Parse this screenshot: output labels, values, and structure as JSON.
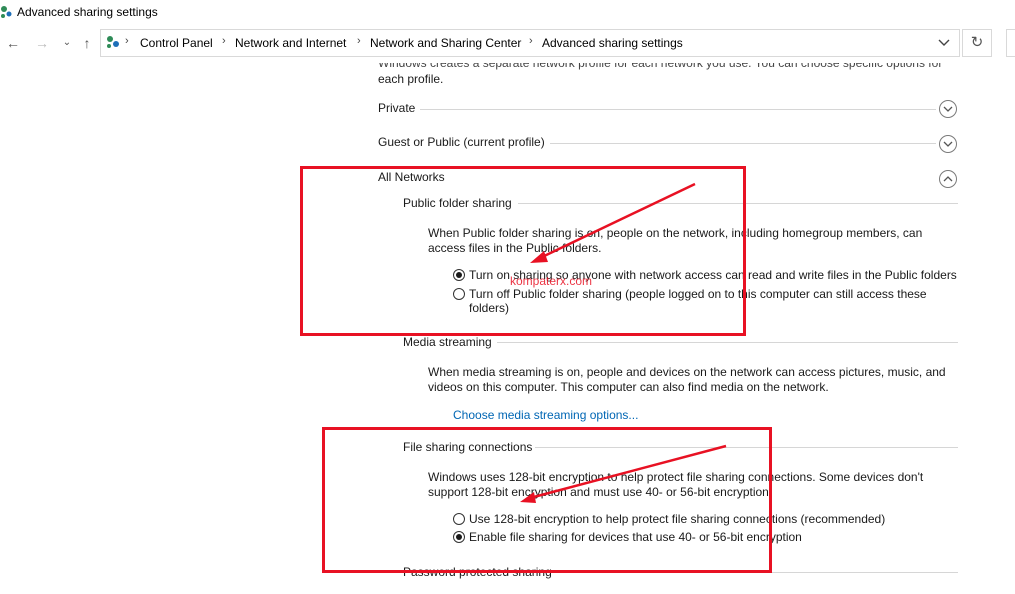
{
  "window": {
    "title": "Advanced sharing settings"
  },
  "nav": {
    "back_icon": "arrow-left-icon",
    "forward_icon": "arrow-right-icon",
    "recent_icon": "chevron-down-icon",
    "up_icon": "arrow-up-icon",
    "breadcrumbs": [
      "Control Panel",
      "Network and Internet",
      "Network and Sharing Center",
      "Advanced sharing settings"
    ],
    "refresh_icon": "refresh-icon"
  },
  "content": {
    "intro_line1": "Windows creates a separate network profile for each network you use. You can choose specific options for",
    "intro_line2": "each profile.",
    "profiles": [
      {
        "label": "Private",
        "state": "collapsed"
      },
      {
        "label": "Guest or Public (current profile)",
        "state": "collapsed"
      },
      {
        "label": "All Networks",
        "state": "expanded"
      }
    ],
    "public_folder": {
      "heading": "Public folder sharing",
      "desc_line1": "When Public folder sharing is on, people on the network, including homegroup members, can",
      "desc_line2": "access files in the Public folders.",
      "option_on": "Turn on sharing so anyone with network access can read and write files in the Public folders",
      "option_off_line1": "Turn off Public folder sharing (people logged on to this computer can still access these",
      "option_off_line2": "folders)",
      "selected": "on"
    },
    "media": {
      "heading": "Media streaming",
      "desc_line1": "When media streaming is on, people and devices on the network can access pictures, music, and",
      "desc_line2": "videos on this computer. This computer can also find media on the network.",
      "link": "Choose media streaming options..."
    },
    "file_sharing": {
      "heading": "File sharing connections",
      "desc_line1": "Windows uses 128-bit encryption to help protect file sharing connections. Some devices don't",
      "desc_line2": "support 128-bit encryption and must use 40- or 56-bit encryption.",
      "option_128": "Use 128-bit encryption to help protect file sharing connections (recommended)",
      "option_40_56": "Enable file sharing for devices that use 40- or 56-bit encryption",
      "selected": "40_56"
    },
    "password": {
      "heading": "Password protected sharing"
    }
  },
  "overlay": {
    "watermark": "kompaterx.com",
    "highlight_color": "#e81123"
  },
  "colors": {
    "link": "#0066b4",
    "accent_red": "#e81123"
  }
}
